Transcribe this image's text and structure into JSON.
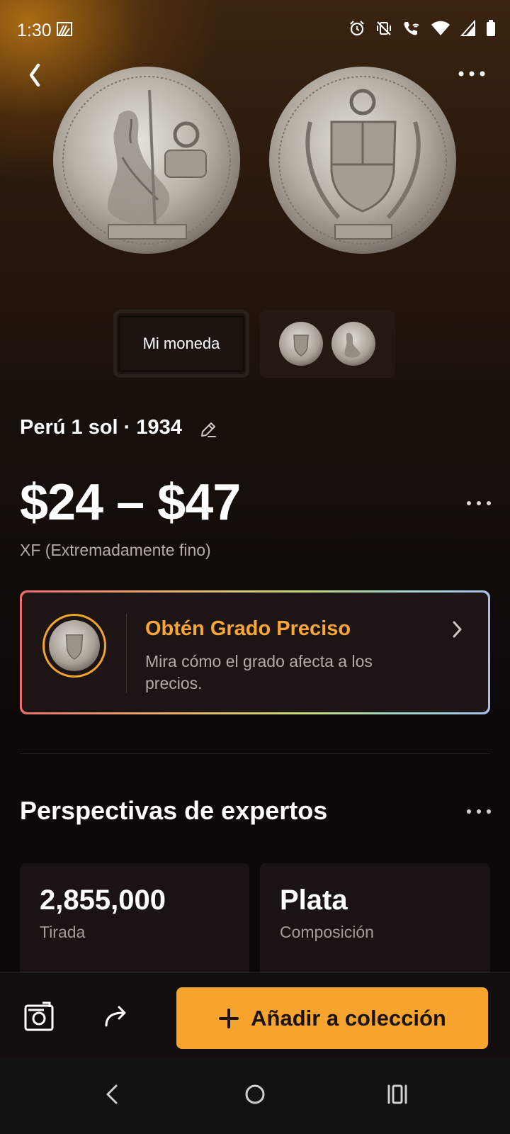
{
  "status_bar": {
    "time": "1:30",
    "icons": [
      "cast-icon",
      "alarm-icon",
      "vibrate-off-icon",
      "wifi-call-icon",
      "wifi-icon",
      "signal-icon",
      "battery-icon"
    ]
  },
  "thumbnails": {
    "mi_moneda_label": "Mi moneda"
  },
  "coin": {
    "title": "Perú 1 sol · 1934",
    "price": "$24 – $47",
    "grade": "XF (Extremadamente fino)"
  },
  "grade_card": {
    "title": "Obtén Grado Preciso",
    "description": "Mira cómo el grado afecta a los precios."
  },
  "experts": {
    "title": "Perspectivas de expertos",
    "stats": [
      {
        "value": "2,855,000",
        "label": "Tirada"
      },
      {
        "value": "Plata",
        "label": "Composición"
      }
    ]
  },
  "actions": {
    "add_label": "Añadir a colección"
  },
  "colors": {
    "accent": "#f7a42e",
    "grade_title": "#f7a637",
    "background": "#0c0807"
  }
}
